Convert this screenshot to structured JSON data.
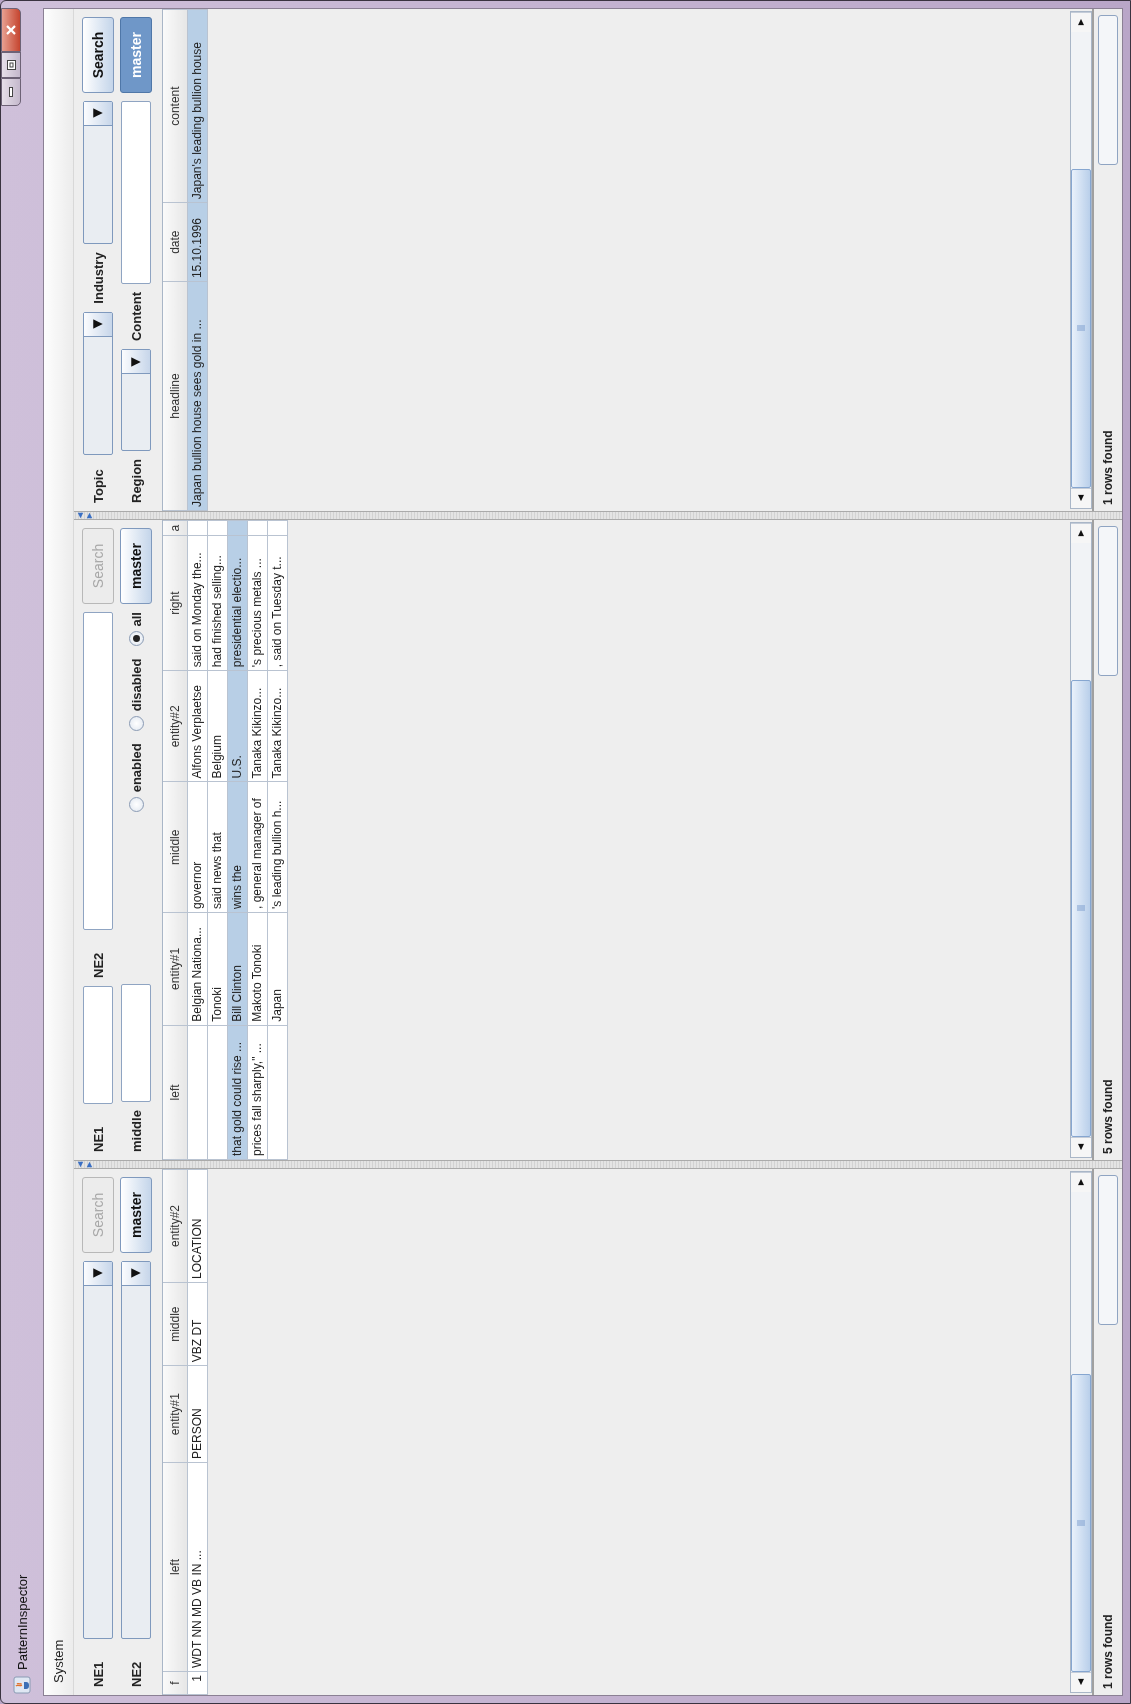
{
  "window": {
    "title": "PatternInspector"
  },
  "menu": [
    {
      "label": "System"
    }
  ],
  "panels": [
    {
      "form": [
        [
          {
            "kind": "label",
            "text": "NE1"
          },
          {
            "kind": "combo"
          },
          {
            "kind": "button",
            "label": "Search",
            "disabled": true
          }
        ],
        [
          {
            "kind": "label",
            "text": "NE2"
          },
          {
            "kind": "combo"
          },
          {
            "kind": "toggle",
            "label": "master",
            "selected": false
          }
        ]
      ],
      "results": {
        "headers": [
          "f",
          "left",
          "entity#1",
          "middle",
          "entity#2"
        ],
        "records": [
          {
            "selected": false,
            "column_1": "1",
            "column_2": "WDT NN MD VB IN ...",
            "column_3": "PERSON",
            "column_4": "VBZ DT",
            "column_5": "LOCATION"
          }
        ]
      },
      "status": "1 rows found",
      "progress": {
        "level": 0
      }
    },
    {
      "form": [
        [
          {
            "kind": "label",
            "text": "NE1"
          },
          {
            "kind": "text"
          },
          {
            "kind": "label",
            "text": "NE2"
          },
          {
            "kind": "text"
          },
          {
            "kind": "button",
            "label": "Search",
            "disabled": true
          }
        ],
        [
          {
            "kind": "label",
            "text": "middle"
          },
          {
            "kind": "text"
          },
          {
            "kind": "radio",
            "label": "enabled",
            "selected": false
          },
          {
            "kind": "radio",
            "label": "disabled",
            "selected": false
          },
          {
            "kind": "radio",
            "label": "all",
            "selected": true
          },
          {
            "kind": "toggle",
            "label": "master",
            "selected": false
          }
        ]
      ],
      "results": {
        "headers": [
          "left",
          "entity#1",
          "middle",
          "entity#2",
          "right",
          "a"
        ],
        "records": [
          {
            "selected": false,
            "column_2": "Belgian Nationa...",
            "column_3": "governor",
            "column_4": "Alfons Verplaetse",
            "column_5": "said on Monday the..."
          },
          {
            "selected": false,
            "column_2": "Tonoki",
            "column_3": "said news that",
            "column_4": "Belgium",
            "column_5": "had finished selling..."
          },
          {
            "selected": true,
            "column_1": "that gold could rise ...",
            "column_2": "Bill Clinton",
            "column_3": "wins the",
            "column_4": "U.S.",
            "column_5": "presidential electio..."
          },
          {
            "selected": false,
            "column_1": "prices fall sharply,\" ...",
            "column_2": "Makoto Tonoki",
            "column_3": ", general manager of",
            "column_4": "Tanaka Kikinzo...",
            "column_5": "'s precious metals ..."
          },
          {
            "selected": false,
            "column_2": "Japan",
            "column_3": "'s leading bullion h...",
            "column_4": "Tanaka Kikinzo...",
            "column_5": ", said on Tuesday t..."
          }
        ]
      },
      "status": "5 rows found",
      "progress": {
        "level": 0
      }
    },
    {
      "form": [
        [
          {
            "kind": "label",
            "text": "Topic"
          },
          {
            "kind": "combo"
          },
          {
            "kind": "label",
            "text": "Industry"
          },
          {
            "kind": "combo"
          },
          {
            "kind": "button",
            "label": "Search",
            "disabled": false
          }
        ],
        [
          {
            "kind": "label",
            "text": "Region"
          },
          {
            "kind": "combo"
          },
          {
            "kind": "label",
            "text": "Content"
          },
          {
            "kind": "text"
          },
          {
            "kind": "toggle",
            "label": "master",
            "selected": true
          }
        ]
      ],
      "results": {
        "headers": [
          "headline",
          "date",
          "content"
        ],
        "records": [
          {
            "selected": true,
            "column_1": "Japan bullion house sees gold in ...",
            "column_2": "15.10.1996",
            "column_3": "Japan's leading bullion house"
          }
        ]
      },
      "status": "1 rows found",
      "progress": {
        "level": 0
      }
    }
  ]
}
